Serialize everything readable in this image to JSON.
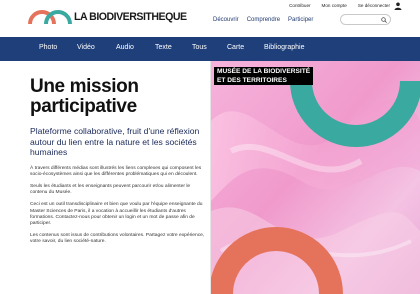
{
  "brand": {
    "name": "LA BIODIVERSITHEQUE"
  },
  "top_links": {
    "contribute": "Contribuer",
    "account": "Mon compte",
    "logout": "Se déconnecter"
  },
  "main_nav": [
    "Découvrir",
    "Comprendre",
    "Participer"
  ],
  "search": {
    "placeholder": ""
  },
  "categories": [
    "Photo",
    "Vidéo",
    "Audio",
    "Texte",
    "Tous",
    "Carte",
    "Bibliographie"
  ],
  "content": {
    "title_line1": "Une mission",
    "title_line2": "participative",
    "subtitle": "Plateforme collaborative, fruit d'une réflexion autour du lien entre la nature et les sociétés humaines",
    "paragraphs": [
      "À travers différents médias sont illustrés les liens complexes qui composent les socio-écosystèmes ainsi que les différentes problématiques qui en découlent.",
      "Seuls les étudiants et les enseignants peuvent parcourir et/ou alimenter le contenu du Musée.",
      "Ceci est un outil transdisciplinaire et bien que voulu par l'équipe enseignante du Master Sciences de Paris, il a vocation à accueillir les étudiants d'autres formations. Contactez-nous pour obtenir un login et un mot de passe afin de participer.",
      "Les contenus sont issus de contributions volontaires. Partagez votre expérience, votre savoir, du lien société-nature."
    ]
  },
  "panel": {
    "label_line1": "MUSÉE DE LA BIODIVERSITÉ",
    "label_line2": "ET DES TERRITOIRES"
  },
  "icons": {
    "user": "user-icon",
    "search": "search-icon",
    "logo": "rainbow-arcs-logo"
  },
  "colors": {
    "nav_bar": "#1f3f7a",
    "arc_red": "#e5735c",
    "arc_teal": "#3aa99f",
    "panel_pink": "#f2a7d6"
  }
}
